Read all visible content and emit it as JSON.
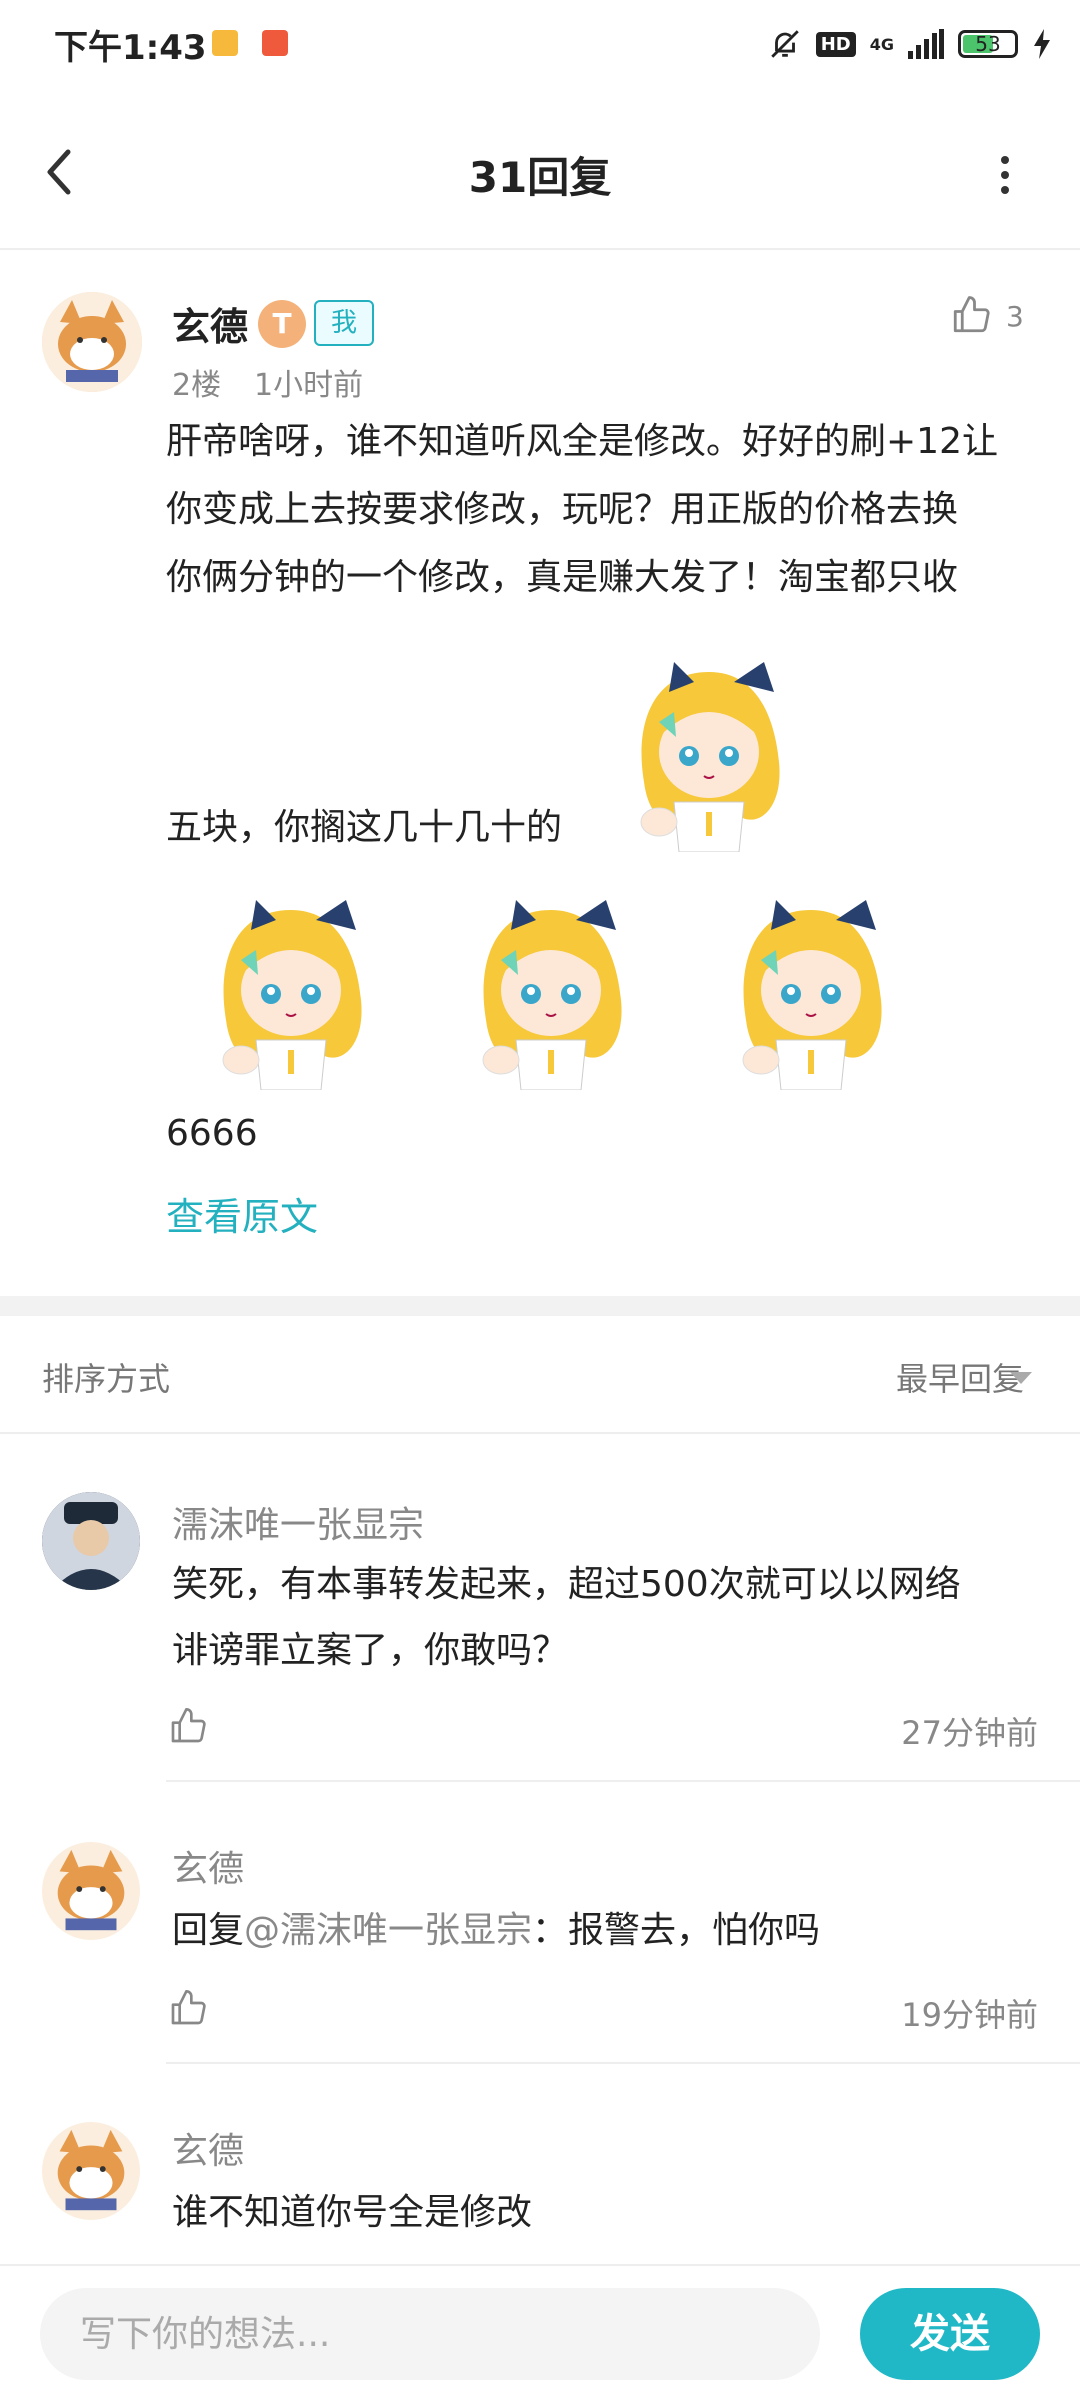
{
  "status_bar": {
    "time": "下午1:43",
    "network": "4G",
    "hd": "HD",
    "battery": "53"
  },
  "header": {
    "title": "31回复"
  },
  "post": {
    "author": "玄德",
    "level": "T",
    "me_badge": "我",
    "floor": "2楼",
    "time": "1小时前",
    "likes": "3",
    "lines": [
      "肝帝啥呀，谁不知道听风全是修改。好好的刷+12让",
      "你变成上去按要求修改，玩呢？用正版的价格去换",
      "你俩分钟的一个修改，真是赚大发了！淘宝都只收",
      "五块，你搁这几十几十的",
      "6666"
    ],
    "view_original": "查看原文"
  },
  "sort": {
    "label": "排序方式",
    "value": "最早回复"
  },
  "comments": [
    {
      "name": "濡沫唯一张显宗",
      "lines": [
        "笑死，有本事转发起来，超过500次就可以以网络",
        "诽谤罪立案了，你敢吗？"
      ],
      "time": "27分钟前"
    },
    {
      "name": "玄德",
      "reply_prefix": "回复",
      "mention": "@濡沫唯一张显宗",
      "text": "：报警去，怕你吗",
      "time": "19分钟前"
    },
    {
      "name": "玄德",
      "text": "谁不知道你号全是修改"
    }
  ],
  "bottom_bar": {
    "placeholder": "写下你的想法...",
    "send": "发送"
  },
  "colors": {
    "accent": "#20b8c6",
    "text": "#222222",
    "muted": "#888888"
  },
  "icons": [
    "back-icon",
    "more-icon",
    "thumb-up-icon",
    "chevron-down-icon",
    "mute-icon",
    "signal-icon",
    "battery-icon",
    "charging-icon"
  ]
}
